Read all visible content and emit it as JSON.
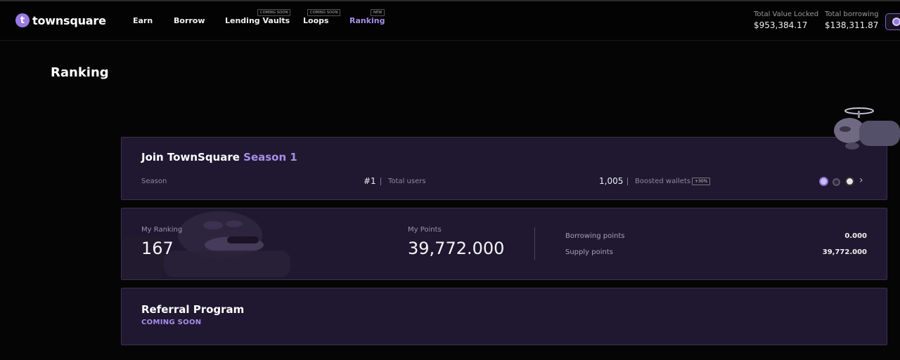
{
  "header": {
    "logo_letter": "t",
    "logo_text": "townsquare",
    "nav": [
      {
        "label": "Earn",
        "badge": ""
      },
      {
        "label": "Borrow",
        "badge": ""
      },
      {
        "label": "Lending Vaults",
        "badge": "COMING SOON"
      },
      {
        "label": "Loops",
        "badge": "COMING SOON"
      },
      {
        "label": "Ranking",
        "badge": "NEW",
        "active": true
      }
    ],
    "stats": [
      {
        "label": "Total Value Locked",
        "value": "$953,384.17"
      },
      {
        "label": "Total borrowing",
        "value": "$138,311.87"
      }
    ],
    "wallet_icon": "wallet-icon"
  },
  "page": {
    "title": "Ranking"
  },
  "season_card": {
    "title": "Join TownSquare",
    "title_accent": "Season 1",
    "season_label": "Season",
    "season_value": "#1",
    "total_users_label": "Total users",
    "total_users_value": "1,005",
    "boosted_label": "Boosted wallets",
    "boost_badge": "+30%",
    "icons": [
      "token-logo-icon",
      "lock-icon",
      "network-icon",
      "chevron-right-icon"
    ],
    "chevron": "›"
  },
  "points_card": {
    "ranking_label": "My Ranking",
    "ranking_value": "167",
    "points_label": "My Points",
    "points_value": "39,772.000",
    "rows": [
      {
        "label": "Borrowing points",
        "value": "0.000"
      },
      {
        "label": "Supply points",
        "value": "39,772.000"
      }
    ]
  },
  "referral_card": {
    "title": "Referral Program",
    "subtitle": "COMING SOON"
  },
  "colors": {
    "accent": "#a98de8",
    "card_bg": "#1f1830",
    "card_border": "#3a3150",
    "page_bg": "#050505"
  }
}
